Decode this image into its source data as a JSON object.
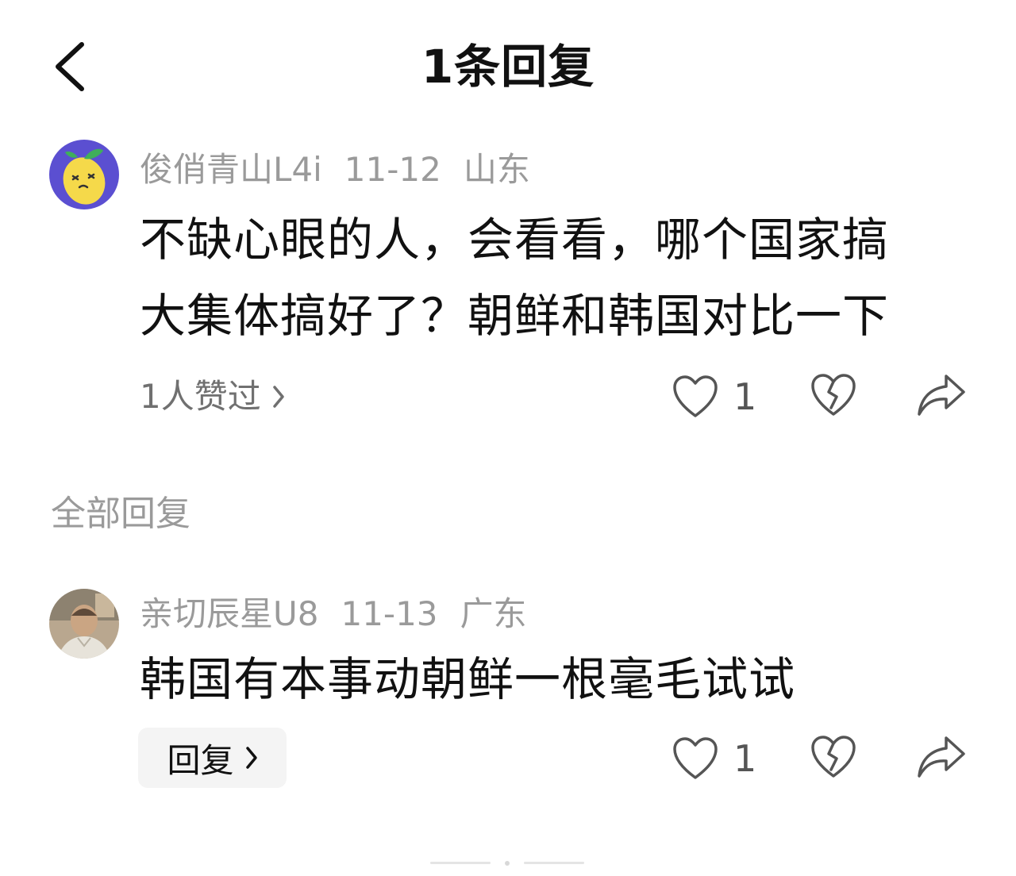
{
  "header": {
    "title": "1条回复",
    "back_icon": "chevron-left-icon"
  },
  "main_comment": {
    "username": "俊俏青山L4i",
    "date": "11-12",
    "location": "山东",
    "line1": "不缺心眼的人，会看看，哪个国家搞",
    "line2": "大集体搞好了？朝鲜和韩国对比一下",
    "likes_summary": "1人赞过",
    "like_count": "1",
    "avatar_icon": "lemon-avatar-icon",
    "avatar_bg": "#5b4fd1"
  },
  "section": {
    "label": "全部回复"
  },
  "reply_comment": {
    "username": "亲切辰星U8",
    "date": "11-13",
    "location": "广东",
    "content": "韩国有本事动朝鲜一根毫毛试试",
    "reply_label": "回复",
    "like_count": "1",
    "avatar_icon": "photo-avatar-icon"
  },
  "icons": {
    "like": "heart-icon",
    "dislike": "broken-heart-icon",
    "share": "share-arrow-icon"
  }
}
